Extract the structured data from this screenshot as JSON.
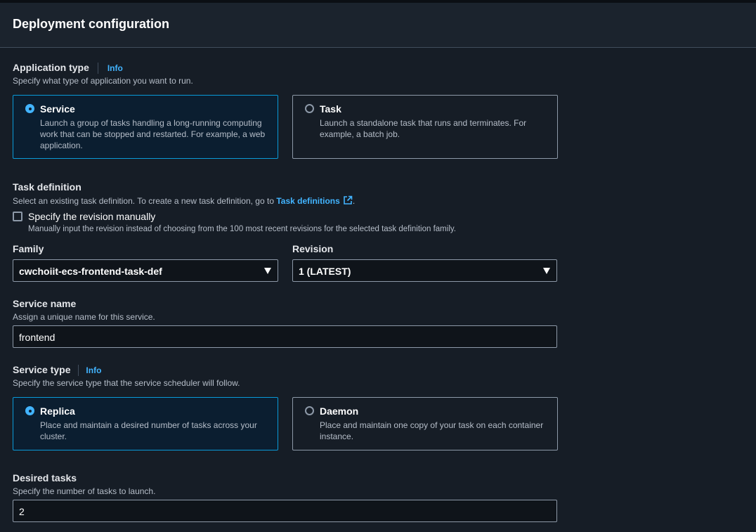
{
  "panel": {
    "title": "Deployment configuration"
  },
  "application_type": {
    "label": "Application type",
    "info": "Info",
    "description": "Specify what type of application you want to run.",
    "options": [
      {
        "title": "Service",
        "description": "Launch a group of tasks handling a long-running computing work that can be stopped and restarted. For example, a web application.",
        "selected": true
      },
      {
        "title": "Task",
        "description": "Launch a standalone task that runs and terminates. For example, a batch job.",
        "selected": false
      }
    ]
  },
  "task_definition": {
    "label": "Task definition",
    "description_prefix": "Select an existing task definition. To create a new task definition, go to ",
    "link_text": "Task definitions",
    "description_suffix": ".",
    "manual_revision": {
      "label": "Specify the revision manually",
      "description": "Manually input the revision instead of choosing from the 100 most recent revisions for the selected task definition family.",
      "checked": false
    },
    "family": {
      "label": "Family",
      "value": "cwchoiit-ecs-frontend-task-def"
    },
    "revision": {
      "label": "Revision",
      "value": "1 (LATEST)"
    }
  },
  "service_name": {
    "label": "Service name",
    "description": "Assign a unique name for this service.",
    "value": "frontend"
  },
  "service_type": {
    "label": "Service type",
    "info": "Info",
    "description": "Specify the service type that the service scheduler will follow.",
    "options": [
      {
        "title": "Replica",
        "description": "Place and maintain a desired number of tasks across your cluster.",
        "selected": true
      },
      {
        "title": "Daemon",
        "description": "Place and maintain one copy of your task on each container instance.",
        "selected": false
      }
    ]
  },
  "desired_tasks": {
    "label": "Desired tasks",
    "description": "Specify the number of tasks to launch.",
    "value": "2"
  },
  "icons": {
    "external_link": "external-link-icon",
    "dropdown": "caret-down-icon"
  },
  "colors": {
    "accent": "#42b4ff",
    "selected_border": "#0a9ad8",
    "selected_bg": "#0b1e30"
  }
}
